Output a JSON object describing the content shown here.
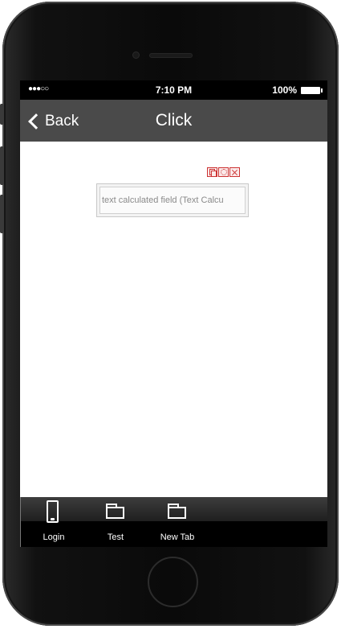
{
  "status_bar": {
    "signal": "●●●○○",
    "time": "7:10 PM",
    "battery": "100%"
  },
  "nav": {
    "back_label": "Back",
    "title": "Click"
  },
  "widget": {
    "field_text": "text calculated field (Text Calcu",
    "action_icons": [
      "copy-icon",
      "gear-icon",
      "close-icon"
    ]
  },
  "tabs": [
    {
      "label": "Login",
      "icon": "phone-icon"
    },
    {
      "label": "Test",
      "icon": "folder-icon"
    },
    {
      "label": "New Tab",
      "icon": "folder-icon"
    }
  ],
  "colors": {
    "nav_bar": "#4a4a4a",
    "accent_red": "#cc3333"
  }
}
